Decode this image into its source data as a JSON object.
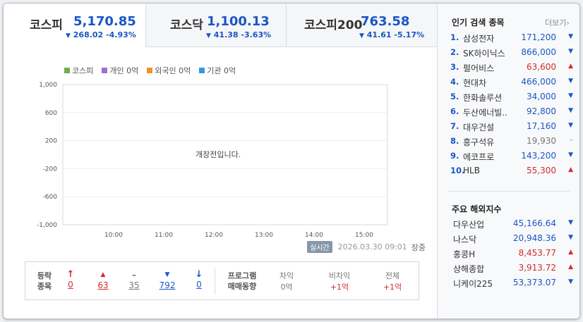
{
  "tabs": [
    {
      "name": "코스피",
      "value": "5,170.85",
      "change": "268.02 -4.93%",
      "active": true
    },
    {
      "name": "코스닥",
      "value": "1,100.13",
      "change": "41.38 -3.63%",
      "active": false
    },
    {
      "name": "코스피200",
      "value": "763.58",
      "change": "41.61 -5.17%",
      "active": false
    }
  ],
  "legend": [
    {
      "label": "코스피",
      "color": "#6ab04c"
    },
    {
      "label": "개인 0억",
      "color": "#a06cd5"
    },
    {
      "label": "외국인 0억",
      "color": "#f0932b"
    },
    {
      "label": "기관 0억",
      "color": "#3498db"
    }
  ],
  "chart_data": {
    "type": "line",
    "yticks": [
      "1,000",
      "600",
      "200",
      "-200",
      "-600",
      "-1,000"
    ],
    "xticks": [
      "10:00",
      "11:00",
      "12:00",
      "13:00",
      "14:00",
      "15:00"
    ],
    "ylim": [
      -1000,
      1000
    ],
    "series": []
  },
  "notice": "개장전입니다.",
  "realtime_badge": "실시간",
  "timestamp": "2026.03.30 09:01",
  "market_status": "장중",
  "stats": {
    "label_line1": "등락",
    "label_line2": "종목",
    "items": [
      {
        "icon": "↑",
        "value": "0",
        "color": "red"
      },
      {
        "icon": "▲",
        "value": "63",
        "color": "red"
      },
      {
        "icon": "–",
        "value": "35",
        "color": "gray"
      },
      {
        "icon": "▼",
        "value": "792",
        "color": "blue"
      },
      {
        "icon": "↓",
        "value": "0",
        "color": "blue"
      }
    ],
    "program_line1": "프로그램",
    "program_line2": "매매동향",
    "program": [
      {
        "label": "차익",
        "value": "0억",
        "color": "gray"
      },
      {
        "label": "비차익",
        "value": "+1억",
        "color": "red"
      },
      {
        "label": "전체",
        "value": "+1억",
        "color": "red"
      }
    ]
  },
  "popular": {
    "title": "인기 검색 종목",
    "more": "더보기",
    "items": [
      {
        "rank": "1.",
        "name": "삼성전자",
        "price": "171,200",
        "dir": "down"
      },
      {
        "rank": "2.",
        "name": "SK하이닉스",
        "price": "866,000",
        "dir": "down"
      },
      {
        "rank": "3.",
        "name": "펄어비스",
        "price": "63,600",
        "dir": "up"
      },
      {
        "rank": "4.",
        "name": "현대차",
        "price": "466,000",
        "dir": "down"
      },
      {
        "rank": "5.",
        "name": "한화솔루션",
        "price": "34,000",
        "dir": "down"
      },
      {
        "rank": "6.",
        "name": "두산에너빌..",
        "price": "92,800",
        "dir": "down"
      },
      {
        "rank": "7.",
        "name": "대우건설",
        "price": "17,160",
        "dir": "down"
      },
      {
        "rank": "8.",
        "name": "흥구석유",
        "price": "19,930",
        "dir": "flat"
      },
      {
        "rank": "9.",
        "name": "에코프로",
        "price": "143,200",
        "dir": "down"
      },
      {
        "rank": "10.",
        "name": "HLB",
        "price": "55,300",
        "dir": "up"
      }
    ]
  },
  "overseas": {
    "title": "주요 해외지수",
    "items": [
      {
        "name": "다우산업",
        "price": "45,166.64",
        "dir": "down"
      },
      {
        "name": "나스닥",
        "price": "20,948.36",
        "dir": "down"
      },
      {
        "name": "홍콩H",
        "price": "8,453.77",
        "dir": "up"
      },
      {
        "name": "상해종합",
        "price": "3,913.72",
        "dir": "up"
      },
      {
        "name": "니케이225",
        "price": "53,373.07",
        "dir": "down"
      }
    ]
  },
  "colors": {
    "up": "#d22b2b",
    "down": "#1a56c6",
    "flat": "#777777"
  }
}
